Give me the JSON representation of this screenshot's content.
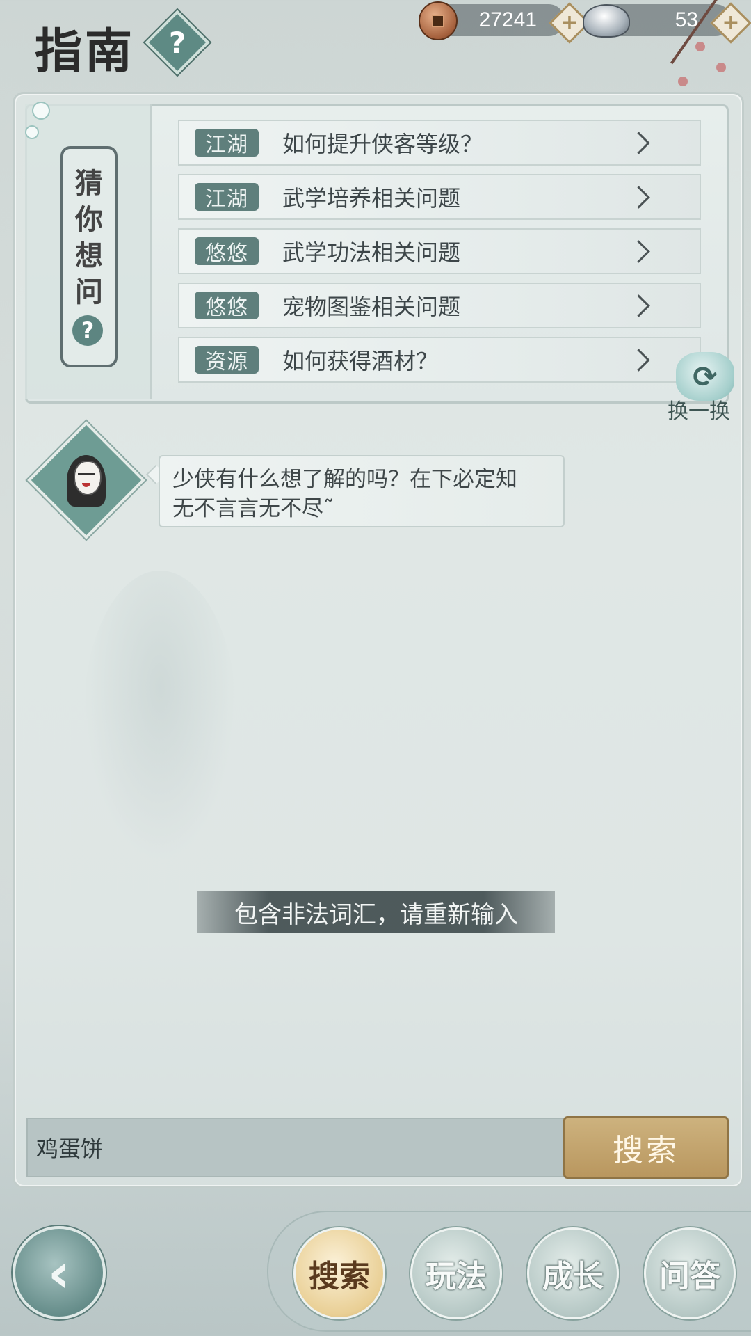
{
  "header": {
    "title": "指南",
    "help_icon": "?",
    "copper": "27241",
    "silver": "53",
    "plus": "+"
  },
  "guess": {
    "label_chars": [
      "猜",
      "你",
      "想",
      "问"
    ],
    "help_icon": "?",
    "questions": [
      {
        "tag": "江湖",
        "text": "如何提升侠客等级？"
      },
      {
        "tag": "江湖",
        "text": "武学培养相关问题"
      },
      {
        "tag": "悠悠",
        "text": "武学功法相关问题"
      },
      {
        "tag": "悠悠",
        "text": "宠物图鉴相关问题"
      },
      {
        "tag": "资源",
        "text": "如何获得酒材？"
      }
    ],
    "refresh_label": "换一换",
    "refresh_icon": "⟳"
  },
  "npc": {
    "line1": "少侠有什么想了解的吗？在下必定知",
    "line2": "无不言言无不尽˜"
  },
  "toast": "包含非法词汇，请重新输入",
  "search": {
    "value": "鸡蛋饼",
    "button": "搜索"
  },
  "nav": {
    "back_icon": "‹",
    "tabs": [
      "搜索",
      "玩法",
      "成长",
      "问答"
    ],
    "active": 0
  },
  "colors": {
    "accent_teal": "#5f7f7c",
    "search_gold": "#b9975f"
  }
}
